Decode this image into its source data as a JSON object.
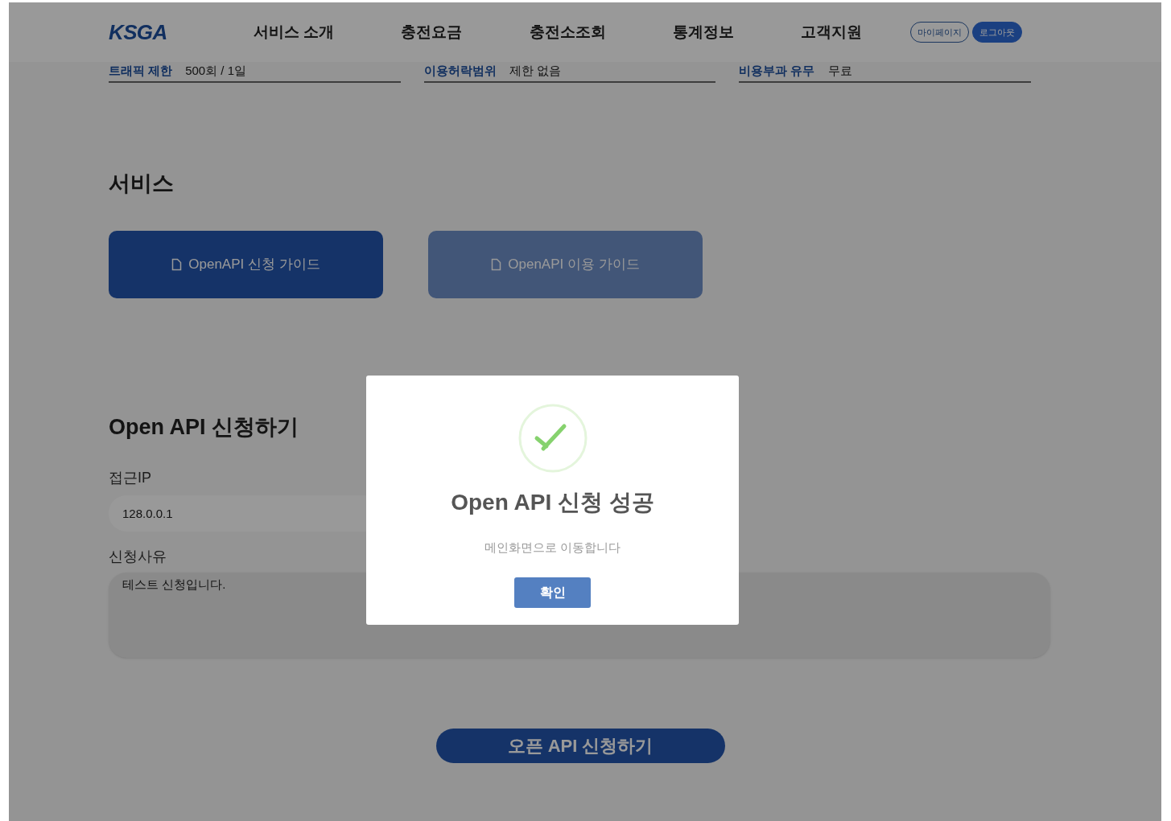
{
  "header": {
    "logo": "KSGA",
    "nav": [
      {
        "label": "서비스 소개"
      },
      {
        "label": "충전요금"
      },
      {
        "label": "충전소조회"
      },
      {
        "label": "통계정보"
      },
      {
        "label": "고객지원"
      }
    ],
    "buttons": [
      {
        "label": "마이페이지",
        "kind": "outline"
      },
      {
        "label": "로그아웃",
        "kind": "filled"
      }
    ]
  },
  "info": [
    {
      "label": "트래픽 제한",
      "value": "500회 / 1일"
    },
    {
      "label": "이용허락범위",
      "value": "제한 없음"
    },
    {
      "label": "비용부과 유무",
      "value": "무료"
    }
  ],
  "services": {
    "title": "서비스",
    "buttons": [
      {
        "label": "OpenAPI 신청 가이드",
        "disabled": false
      },
      {
        "label": "OpenAPI 이용 가이드",
        "disabled": true
      }
    ]
  },
  "form": {
    "title": "Open API 신청하기",
    "fields": [
      {
        "label": "접근IP",
        "value": "128.0.0.1",
        "kind": "input"
      },
      {
        "label": "신청사유",
        "value": "테스트 신청입니다.",
        "kind": "textarea"
      }
    ],
    "submit": "오픈 API 신청하기"
  },
  "dialog": {
    "title": "Open API 신청 성공",
    "message": "메인화면으로 이동합니다",
    "button": "확인"
  }
}
